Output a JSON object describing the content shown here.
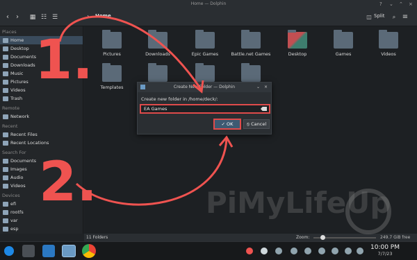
{
  "window": {
    "title": "Home — Dolphin"
  },
  "toolbar": {
    "breadcrumb": "Home",
    "split_label": "Split"
  },
  "sidebar": {
    "places_heading": "Places",
    "places": [
      {
        "label": "Home",
        "icon": "home-icon"
      },
      {
        "label": "Desktop",
        "icon": "desktop-icon"
      },
      {
        "label": "Documents",
        "icon": "documents-icon"
      },
      {
        "label": "Downloads",
        "icon": "downloads-icon"
      },
      {
        "label": "Music",
        "icon": "music-icon"
      },
      {
        "label": "Pictures",
        "icon": "pictures-icon"
      },
      {
        "label": "Videos",
        "icon": "videos-icon"
      },
      {
        "label": "Trash",
        "icon": "trash-icon"
      }
    ],
    "remote_heading": "Remote",
    "remote": [
      {
        "label": "Network",
        "icon": "network-icon"
      }
    ],
    "recent_heading": "Recent",
    "recent": [
      {
        "label": "Recent Files",
        "icon": "recent-files-icon"
      },
      {
        "label": "Recent Locations",
        "icon": "recent-locations-icon"
      }
    ],
    "search_heading": "Search For",
    "search": [
      {
        "label": "Documents",
        "icon": "documents-icon"
      },
      {
        "label": "Images",
        "icon": "images-icon"
      },
      {
        "label": "Audio",
        "icon": "audio-icon"
      },
      {
        "label": "Videos",
        "icon": "videos-icon"
      }
    ],
    "devices_heading": "Devices",
    "devices": [
      {
        "label": "efi",
        "icon": "drive-icon"
      },
      {
        "label": "rootfs",
        "icon": "drive-icon"
      },
      {
        "label": "var",
        "icon": "drive-icon"
      },
      {
        "label": "esp",
        "icon": "drive-icon"
      }
    ]
  },
  "folders": [
    {
      "label": "Pictures"
    },
    {
      "label": "Downloads"
    },
    {
      "label": "Epic Games"
    },
    {
      "label": "Battle.net Games"
    },
    {
      "label": "Desktop"
    },
    {
      "label": "Games"
    },
    {
      "label": "Videos"
    },
    {
      "label": "Templates"
    },
    {
      "label": ""
    },
    {
      "label": ""
    },
    {
      "label": ""
    }
  ],
  "status": {
    "count": "11 Folders",
    "zoom_label": "Zoom:",
    "free_space": "249.7 GiB free"
  },
  "dialog": {
    "title": "Create New Folder — Dolphin",
    "prompt": "Create new folder in /home/deck/:",
    "input_value": "EA Games",
    "ok_label": "✓ OK",
    "cancel_label": "⦸ Cancel"
  },
  "annotations": {
    "step1": "1.",
    "step2": "2."
  },
  "watermark": "PiMyLifeUp",
  "taskbar": {
    "time": "10:00 PM",
    "date": "7/7/23"
  },
  "colors": {
    "accent_red": "#e04b4b",
    "selection_blue": "#3a4b5c"
  }
}
